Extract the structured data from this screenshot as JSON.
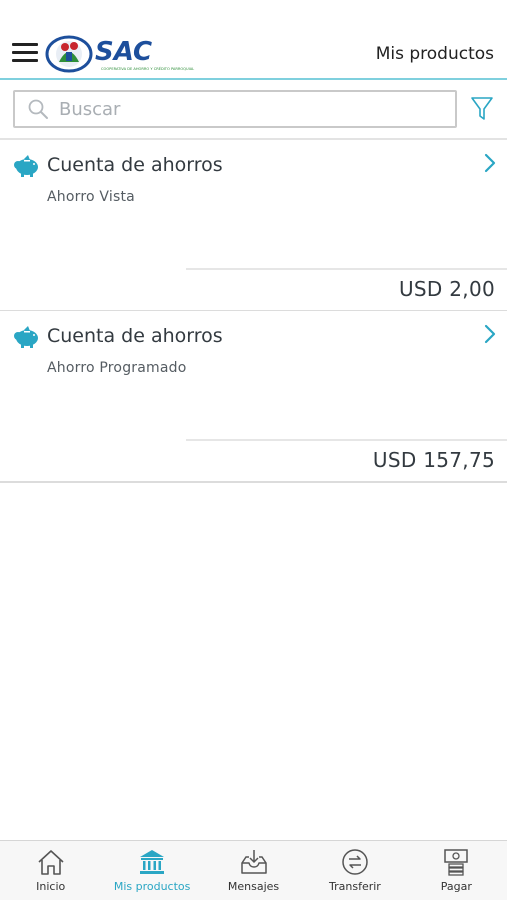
{
  "header": {
    "title": "Mis productos",
    "logo_text": "SAC",
    "logo_tagline": "COOPERATIVA DE AHORRO Y CRÉDITO PARROQUIAL"
  },
  "search": {
    "placeholder": "Buscar",
    "value": ""
  },
  "products": [
    {
      "icon": "piggy-bank-icon",
      "title": "Cuenta de ahorros",
      "subtitle": "Ahorro Vista",
      "amount": "USD 2,00"
    },
    {
      "icon": "piggy-bank-icon",
      "title": "Cuenta de ahorros",
      "subtitle": "Ahorro Programado",
      "amount": "USD 157,75"
    }
  ],
  "bottom_nav": {
    "items": [
      {
        "label": "Inicio",
        "icon": "home-icon",
        "active": false
      },
      {
        "label": "Mis productos",
        "icon": "bank-icon",
        "active": true
      },
      {
        "label": "Mensajes",
        "icon": "inbox-icon",
        "active": false
      },
      {
        "label": "Transferir",
        "icon": "transfer-icon",
        "active": false
      },
      {
        "label": "Pagar",
        "icon": "payment-icon",
        "active": false
      }
    ]
  },
  "colors": {
    "accent": "#2aa6c4",
    "header_border": "#7fd0de",
    "text": "#333a40",
    "logo_blue": "#1d4f9c",
    "logo_red": "#c8262e",
    "logo_green": "#2f8f3a"
  }
}
